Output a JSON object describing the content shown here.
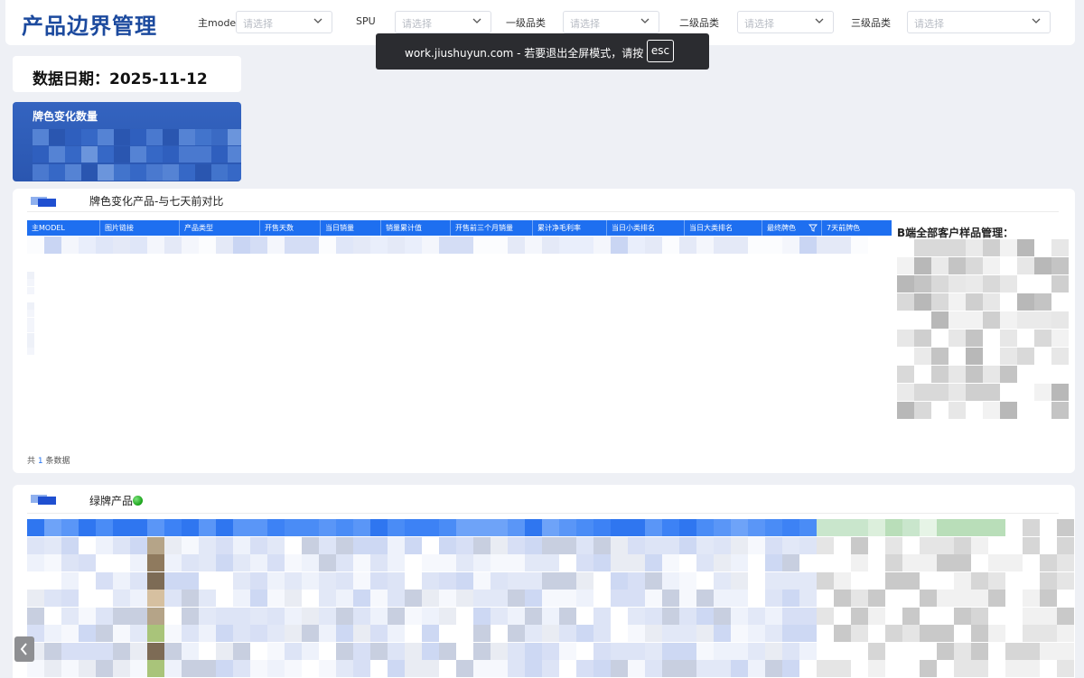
{
  "header": {
    "title": "产品边界管理",
    "filters": [
      {
        "label": "主model",
        "placeholder": "请选择"
      },
      {
        "label": "SPU",
        "placeholder": "请选择"
      },
      {
        "label": "一级品类",
        "placeholder": "请选择"
      },
      {
        "label": "二级品类",
        "placeholder": "请选择"
      },
      {
        "label": "三级品类",
        "placeholder": "请选择"
      }
    ]
  },
  "toast": {
    "message": "work.jiushuyun.com - 若要退出全屏模式，请按",
    "key": "esc"
  },
  "date_card": {
    "text": "数据日期：2025-11-12"
  },
  "count_card": {
    "title": "牌色变化数量"
  },
  "change_section": {
    "title": "牌色变化产品-与七天前对比",
    "columns": [
      "主MODEL",
      "图片链接",
      "产品类型",
      "开售天数",
      "当日销量",
      "销量累计值",
      "开售前三个月销量",
      "累计净毛利率",
      "当日小类排名",
      "当日大类排名",
      "最终牌色",
      "7天前牌色"
    ],
    "pager_prefix": "共",
    "pager_count": "1",
    "pager_suffix": "条数据",
    "side_title": "B端全部客户样品管理："
  },
  "green_section": {
    "title": "绿牌产品"
  },
  "colors": {
    "brand": "#1c4a9e",
    "table_header": "#1e6ff0",
    "card": "#2a56b0"
  }
}
